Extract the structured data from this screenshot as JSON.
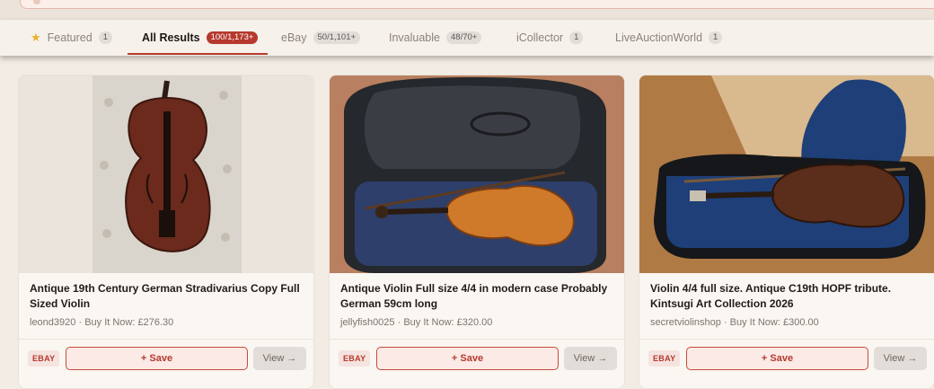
{
  "tabs": [
    {
      "label": "Featured",
      "count": "1",
      "icon": "star-icon"
    },
    {
      "label": "All Results",
      "count": "100/1,173+",
      "active": true
    },
    {
      "label": "eBay",
      "count": "50/1,101+"
    },
    {
      "label": "Invaluable",
      "count": "48/70+"
    },
    {
      "label": "iCollector",
      "count": "1"
    },
    {
      "label": "LiveAuctionWorld",
      "count": "1"
    }
  ],
  "colors": {
    "accent": "#b6392d",
    "page_bg": "#f2ece4",
    "card_bg": "#faf6f1",
    "badge_bg": "#e1ddd8"
  },
  "results": [
    {
      "title": "Antique 19th Century German Stradivarius Copy Full Sized Violin",
      "seller": "leond3920",
      "price_text": "Buy It Now: £276.30",
      "source": "EBAY",
      "save_label": "+ Save",
      "view_label": "View →",
      "image": "violin-on-tufted-leather-photo"
    },
    {
      "title": "Antique Violin Full size 4/4 in modern case Probably German 59cm long",
      "seller": "jellyfish0025",
      "price_text": "Buy It Now: £320.00",
      "source": "EBAY",
      "save_label": "+ Save",
      "view_label": "View →",
      "image": "violin-in-grey-case-photo"
    },
    {
      "title": "Violin 4/4 full size. Antique C19th HOPF tribute. Kintsugi Art Collection 2026",
      "seller": "secretviolinshop",
      "price_text": "Buy It Now: £300.00",
      "source": "EBAY",
      "save_label": "+ Save",
      "view_label": "View →",
      "image": "violin-in-blue-lined-case-photo"
    }
  ]
}
